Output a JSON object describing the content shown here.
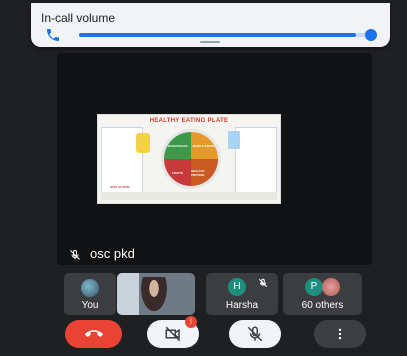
{
  "volume_overlay": {
    "title": "In-call volume",
    "level": 0.95,
    "icon": "phone-icon"
  },
  "main_tile": {
    "presenter_name": "osc pkd",
    "mic_icon": "mic-off-icon",
    "slide": {
      "title": "HEALTHY EATING PLATE",
      "sections": [
        "VEGETABLES",
        "WHOLE GRAINS",
        "FRUITS",
        "HEALTHY PROTEIN"
      ],
      "footer_text": "STAY ACTIVE!"
    }
  },
  "participants": [
    {
      "label": "You",
      "icon": "avatar-photo"
    },
    {
      "label": "",
      "icon": "video-feed"
    },
    {
      "label": "Harsha",
      "initial": "H",
      "icon": "mic-off-icon"
    },
    {
      "label": "60 others",
      "initial": "P",
      "icon": "mic-off-icon"
    }
  ],
  "controls": {
    "camera_badge": "!",
    "hangup_icon": "hang-up-icon",
    "camera_icon": "camera-off-icon",
    "mic_icon": "mic-off-icon",
    "more_icon": "more-vert-icon"
  },
  "colors": {
    "accent": "#1a73e8",
    "hangup": "#ea4335",
    "background": "#1f2022"
  }
}
